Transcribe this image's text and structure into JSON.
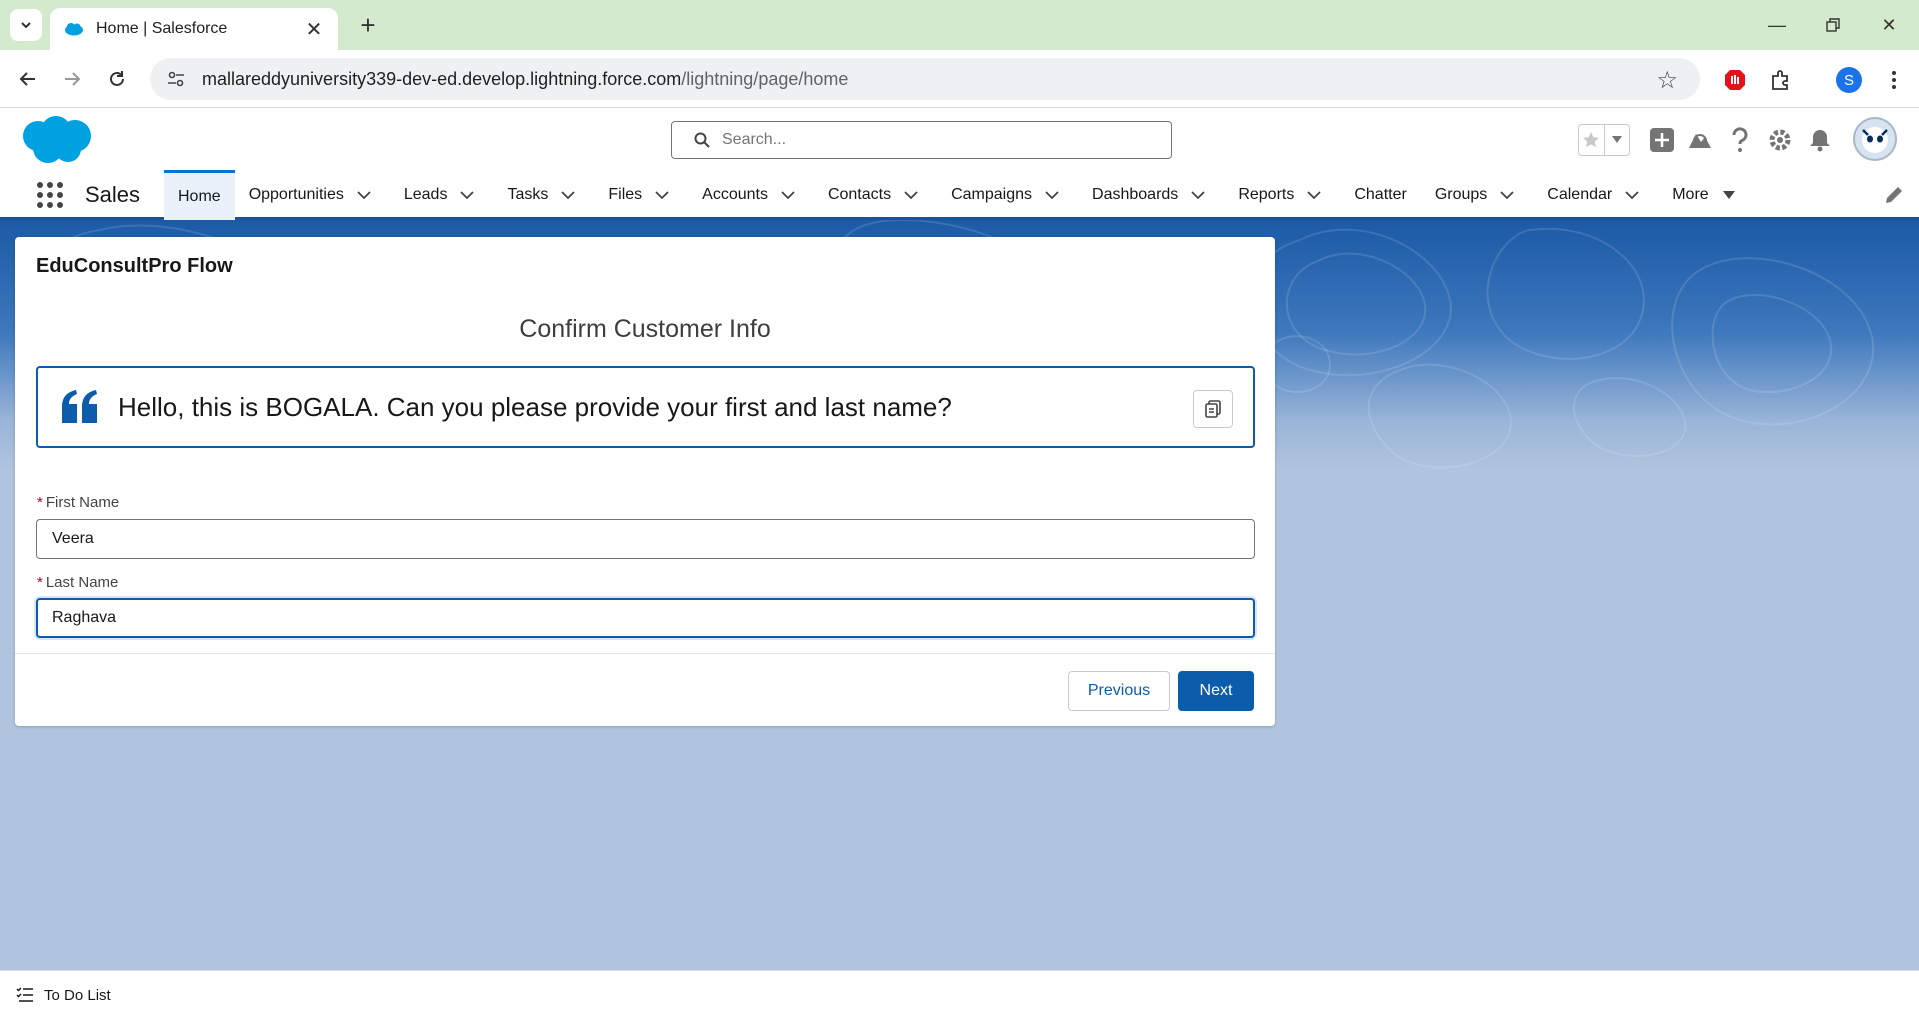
{
  "browser": {
    "tab_title": "Home | Salesforce",
    "url_host": "mallareddyuniversity339-dev-ed.develop.lightning.force.com",
    "url_path": "/lightning/page/home",
    "profile_initial": "S"
  },
  "header": {
    "search_placeholder": "Search..."
  },
  "nav": {
    "app_name": "Sales",
    "items": [
      {
        "label": "Home",
        "active": true,
        "menu": false
      },
      {
        "label": "Opportunities",
        "menu": true
      },
      {
        "label": "Leads",
        "menu": true
      },
      {
        "label": "Tasks",
        "menu": true
      },
      {
        "label": "Files",
        "menu": true
      },
      {
        "label": "Accounts",
        "menu": true
      },
      {
        "label": "Contacts",
        "menu": true
      },
      {
        "label": "Campaigns",
        "menu": true
      },
      {
        "label": "Dashboards",
        "menu": true
      },
      {
        "label": "Reports",
        "menu": true
      },
      {
        "label": "Chatter",
        "menu": false
      },
      {
        "label": "Groups",
        "menu": true
      },
      {
        "label": "Calendar",
        "menu": true
      },
      {
        "label": "More",
        "menu": true
      }
    ]
  },
  "flow": {
    "title": "EduConsultPro Flow",
    "screen_title": "Confirm Customer Info",
    "quote": "Hello, this is BOGALA. Can you please provide your first and last name?",
    "first_name": {
      "label": "First Name",
      "required_mark": "*",
      "value": "Veera"
    },
    "last_name": {
      "label": "Last Name",
      "required_mark": "*",
      "value": "Raghava"
    },
    "previous_label": "Previous",
    "next_label": "Next"
  },
  "utility": {
    "todo_label": "To Do List"
  },
  "colors": {
    "brand_blue": "#0b5cab",
    "nav_border": "#1b5297",
    "page_background": "#b0c4de",
    "tab_strip": "#d3eacd"
  }
}
